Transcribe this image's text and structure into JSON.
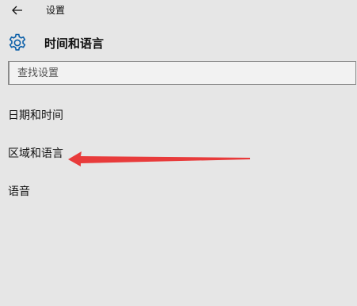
{
  "window": {
    "title": "设置",
    "back_icon": "arrow-left-icon"
  },
  "header": {
    "icon": "gear-icon",
    "title": "时间和语言",
    "accent_color": "#0a5ea8"
  },
  "search": {
    "placeholder": "查找设置",
    "value": ""
  },
  "nav": {
    "items": [
      {
        "label": "日期和时间"
      },
      {
        "label": "区域和语言"
      },
      {
        "label": "语音"
      }
    ]
  },
  "annotation": {
    "type": "arrow",
    "color": "#e83b3b",
    "points_to": "区域和语言"
  }
}
